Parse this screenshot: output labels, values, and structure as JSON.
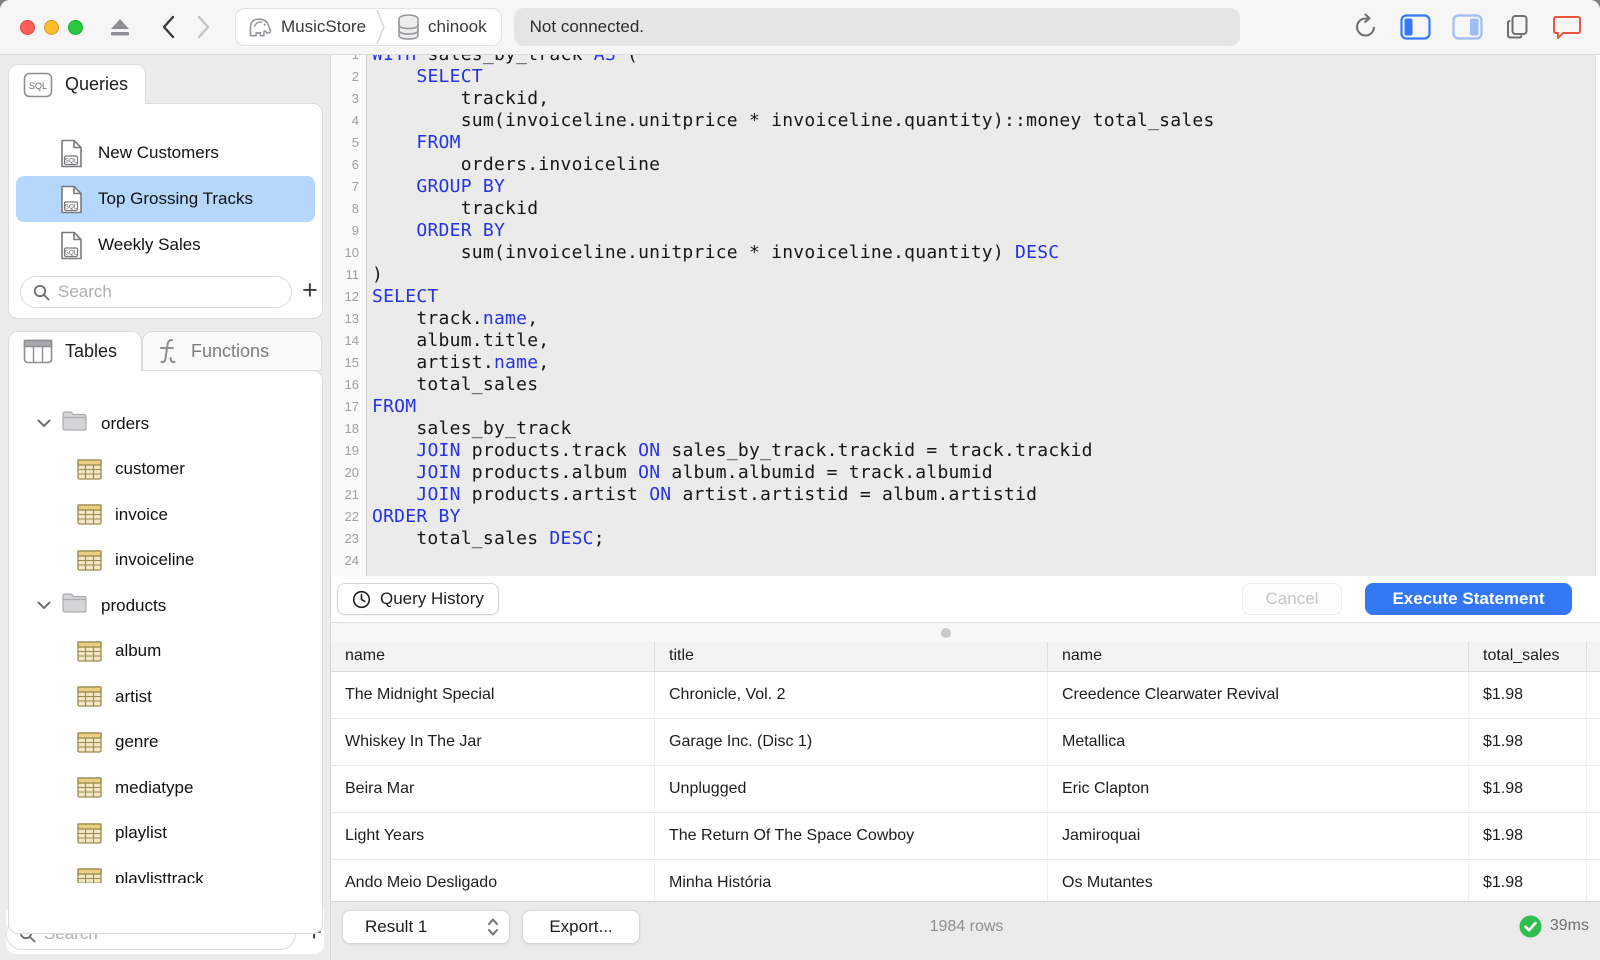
{
  "titlebar": {
    "breadcrumb": {
      "connection": "MusicStore",
      "database": "chinook"
    },
    "status": "Not connected.",
    "icons": [
      "eject-icon",
      "back-icon",
      "forward-icon",
      "elephant-icon",
      "database-icon",
      "refresh-icon",
      "panel-left-icon",
      "panel-right-icon",
      "windows-icon",
      "chat-icon"
    ]
  },
  "sidebar": {
    "queries": {
      "tab_label": "Queries",
      "items": [
        {
          "label": "New Customers",
          "selected": false
        },
        {
          "label": "Top Grossing Tracks",
          "selected": true
        },
        {
          "label": "Weekly Sales",
          "selected": false
        }
      ],
      "search_placeholder": "Search",
      "add_label": "+"
    },
    "tables": {
      "tab_label": "Tables",
      "functions_tab_label": "Functions",
      "tree": [
        {
          "type": "schema",
          "label": "orders",
          "expanded": true
        },
        {
          "type": "table",
          "label": "customer"
        },
        {
          "type": "table",
          "label": "invoice"
        },
        {
          "type": "table",
          "label": "invoiceline"
        },
        {
          "type": "schema",
          "label": "products",
          "expanded": true
        },
        {
          "type": "table",
          "label": "album"
        },
        {
          "type": "table",
          "label": "artist"
        },
        {
          "type": "table",
          "label": "genre"
        },
        {
          "type": "table",
          "label": "mediatype"
        },
        {
          "type": "table",
          "label": "playlist"
        },
        {
          "type": "table",
          "label": "playlisttrack"
        }
      ],
      "search_placeholder": "Search",
      "add_label": "+"
    }
  },
  "editor": {
    "line_count": 24,
    "lines": [
      [
        [
          "WITH ",
          "k"
        ],
        [
          "sales_by_track ",
          "p"
        ],
        [
          "AS ",
          "k"
        ],
        [
          "(",
          "p"
        ]
      ],
      [
        [
          "    ",
          "p"
        ],
        [
          "SELECT",
          "k"
        ]
      ],
      [
        [
          "        trackid,",
          "p"
        ]
      ],
      [
        [
          "        sum(invoiceline.unitprice * invoiceline.quantity)::money total_sales",
          "p"
        ]
      ],
      [
        [
          "    ",
          "p"
        ],
        [
          "FROM",
          "k"
        ]
      ],
      [
        [
          "        orders.invoiceline",
          "p"
        ]
      ],
      [
        [
          "    ",
          "p"
        ],
        [
          "GROUP BY",
          "k"
        ]
      ],
      [
        [
          "        trackid",
          "p"
        ]
      ],
      [
        [
          "    ",
          "p"
        ],
        [
          "ORDER BY",
          "k"
        ]
      ],
      [
        [
          "        sum(invoiceline.unitprice * invoiceline.quantity) ",
          "p"
        ],
        [
          "DESC",
          "k"
        ]
      ],
      [
        [
          ")",
          "p"
        ]
      ],
      [
        [
          "SELECT",
          "k"
        ]
      ],
      [
        [
          "    track.",
          "p"
        ],
        [
          "name",
          "k"
        ],
        [
          ",",
          "p"
        ]
      ],
      [
        [
          "    album.title,",
          "p"
        ]
      ],
      [
        [
          "    artist.",
          "p"
        ],
        [
          "name",
          "k"
        ],
        [
          ",",
          "p"
        ]
      ],
      [
        [
          "    total_sales",
          "p"
        ]
      ],
      [
        [
          "FROM",
          "k"
        ]
      ],
      [
        [
          "    sales_by_track",
          "p"
        ]
      ],
      [
        [
          "    ",
          "p"
        ],
        [
          "JOIN ",
          "k"
        ],
        [
          "products.track ",
          "p"
        ],
        [
          "ON ",
          "k"
        ],
        [
          "sales_by_track.trackid = track.trackid",
          "p"
        ]
      ],
      [
        [
          "    ",
          "p"
        ],
        [
          "JOIN ",
          "k"
        ],
        [
          "products.album ",
          "p"
        ],
        [
          "ON ",
          "k"
        ],
        [
          "album.albumid = track.albumid",
          "p"
        ]
      ],
      [
        [
          "    ",
          "p"
        ],
        [
          "JOIN ",
          "k"
        ],
        [
          "products.artist ",
          "p"
        ],
        [
          "ON ",
          "k"
        ],
        [
          "artist.artistid = album.artistid",
          "p"
        ]
      ],
      [
        [
          "ORDER BY",
          "k"
        ]
      ],
      [
        [
          "    total_sales ",
          "p"
        ],
        [
          "DESC",
          "k"
        ],
        [
          ";",
          "p"
        ]
      ],
      [
        [
          "",
          "p"
        ]
      ]
    ]
  },
  "editor_actions": {
    "query_history": "Query History",
    "cancel": "Cancel",
    "execute": "Execute Statement"
  },
  "results": {
    "columns": [
      "name",
      "title",
      "name",
      "total_sales"
    ],
    "rows": [
      [
        "The Midnight Special",
        "Chronicle, Vol. 2",
        "Creedence Clearwater Revival",
        "$1.98"
      ],
      [
        "Whiskey In The Jar",
        "Garage Inc. (Disc 1)",
        "Metallica",
        "$1.98"
      ],
      [
        "Beira Mar",
        "Unplugged",
        "Eric Clapton",
        "$1.98"
      ],
      [
        "Light Years",
        "The Return Of The Space Cowboy",
        "Jamiroquai",
        "$1.98"
      ],
      [
        "Ando Meio Desligado",
        "Minha História",
        "Os Mutantes",
        "$1.98"
      ]
    ]
  },
  "statusbar": {
    "result_selector": "Result 1",
    "export_label": "Export...",
    "row_count": "1984 rows",
    "duration": "39ms"
  },
  "colors": {
    "accent_blue": "#3478f6",
    "selection_blue": "#b5d7fb",
    "keyword_blue": "#2433e8",
    "success_green": "#2fbe4f",
    "chat_orange": "#e8573f"
  }
}
